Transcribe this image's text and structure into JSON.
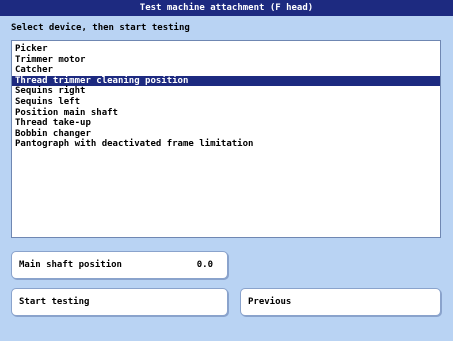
{
  "window": {
    "title": "Test machine attachment (F head)"
  },
  "instruction": "Select device, then start testing",
  "device_list": {
    "selected_index": 3,
    "items": [
      "Picker",
      "Trimmer motor",
      "Catcher",
      "Thread trimmer cleaning position",
      "Sequins right",
      "Sequins left",
      "Position main shaft",
      "Thread take-up",
      "Bobbin changer",
      "Pantograph with deactivated frame limitation"
    ]
  },
  "main_shaft": {
    "label": "Main shaft position",
    "value": "0.0"
  },
  "buttons": {
    "start_label": "Start testing",
    "previous_label": "Previous"
  },
  "colors": {
    "background": "#b9d3f3",
    "title_bar": "#1d2a80",
    "selection": "#1d2a80",
    "list_background": "#ffffff"
  }
}
